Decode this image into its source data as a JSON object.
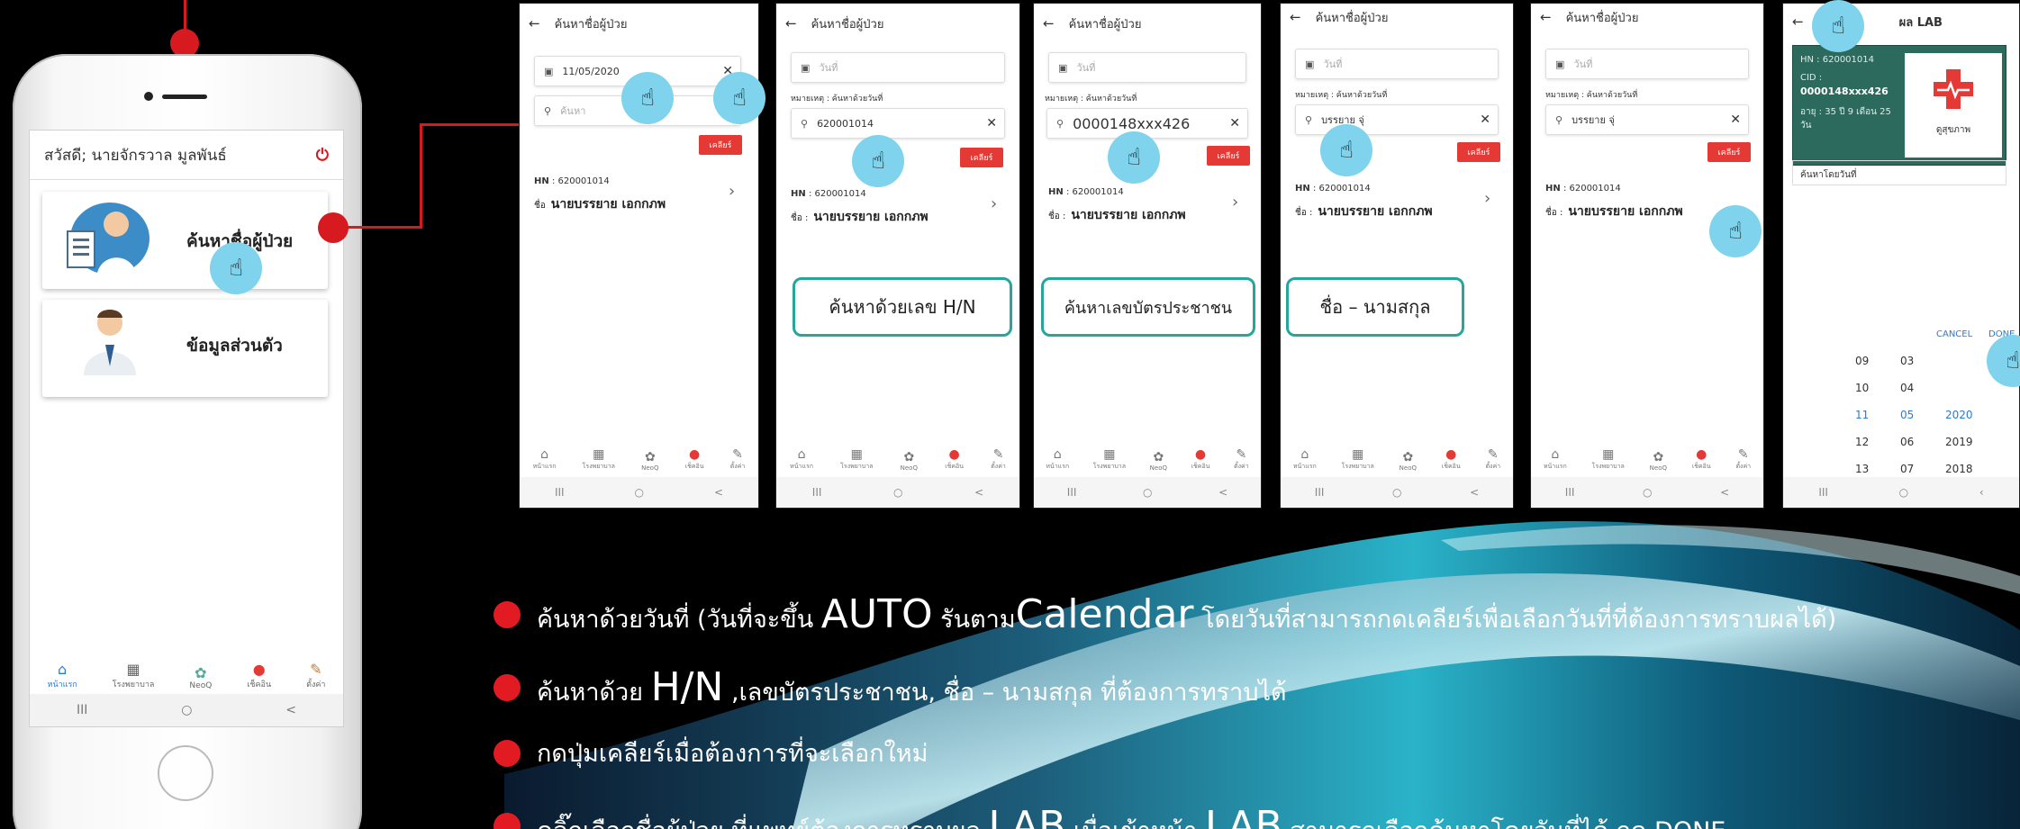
{
  "colors": {
    "accent": "#d71920",
    "teal": "#26a69a",
    "bullet": "#e21b22",
    "tap": "#7fd3ec"
  },
  "main_phone": {
    "greeting": "สวัสดี; นายจักรวาล มูลพันธ์",
    "power_icon": "power-icon",
    "cards": [
      {
        "label": "ค้นหาชื่อผู้ป่วย",
        "icon": "doctor-clipboard-icon"
      },
      {
        "label": "ข้อมูลส่วนตัว",
        "icon": "doctor-avatar-icon"
      }
    ],
    "nav": [
      {
        "label": "หน้าแรก",
        "icon": "home-icon"
      },
      {
        "label": "โรงพยาบาล",
        "icon": "hospital-icon"
      },
      {
        "label": "NeoQ",
        "icon": "neoq-icon"
      },
      {
        "label": "เช็คอิน",
        "icon": "location-pin-icon"
      },
      {
        "label": "ตั้งค่า",
        "icon": "settings-icon"
      }
    ],
    "sys": [
      "III",
      "○",
      "<"
    ]
  },
  "screens": [
    {
      "title": "ค้นหาชื่อผู้ป่วย",
      "date_value": "11/05/2020",
      "search_placeholder": "ค้นหา",
      "clear_label": "เคลียร์",
      "hn_label": "HN",
      "hn_value": ": 620001014",
      "name_prefix": "ชื่อ",
      "name_value": "นายบรรยาย เอกกภพ"
    },
    {
      "title": "ค้นหาชื่อผู้ป่วย",
      "date_placeholder": "วันที่",
      "hint": "หมายเหตุ : ค้นหาด้วยวันที่",
      "search_value": "620001014",
      "clear_label": "เคลียร์",
      "hn_label": "HN",
      "hn_value": ": 620001014",
      "name_prefix": "ชื่อ :",
      "name_value": "นายบรรยาย เอกกภพ"
    },
    {
      "title": "ค้นหาชื่อผู้ป่วย",
      "date_placeholder": "วันที่",
      "hint": "หมายเหตุ : ค้นหาด้วยวันที่",
      "search_value": "0000148xxx426",
      "clear_label": "เคลียร์",
      "hn_label": "HN",
      "hn_value": ": 620001014",
      "name_prefix": "ชื่อ :",
      "name_value": "นายบรรยาย เอกกภพ"
    },
    {
      "title": "ค้นหาชื่อผู้ป่วย",
      "date_placeholder": "วันที่",
      "hint": "หมายเหตุ : ค้นหาด้วยวันที่",
      "search_value": "บรรยาย จุ่",
      "clear_label": "เคลียร์",
      "hn_label": "HN",
      "hn_value": ": 620001014",
      "name_prefix": "ชื่อ :",
      "name_value": "นายบรรยาย เอกกภพ"
    },
    {
      "title": "ค้นหาชื่อผู้ป่วย",
      "date_placeholder": "วันที่",
      "hint": "หมายเหตุ : ค้นหาด้วยวันที่",
      "search_value": "บรรยาย จุ่",
      "clear_label": "เคลียร์",
      "hn_label": "HN",
      "hn_value": ": 620001014",
      "name_prefix": "ชื่อ :",
      "name_value": "นายบรรยาย เอกกภพ"
    }
  ],
  "lab_screen": {
    "title": "ผล LAB",
    "hn": "HN : 620001014",
    "cid_label": "CID :",
    "cid_value": "0000148xxx426",
    "age": "อายุ : 35 ปี 9 เดือน 25 วัน",
    "health_label": "ดูสุขภาพ",
    "search_by_date": "ค้นหาโดยวันที่",
    "cancel": "CANCEL",
    "done": "DONE",
    "picker_rows": [
      [
        "09",
        "03",
        ""
      ],
      [
        "10",
        "04",
        ""
      ],
      [
        "11",
        "05",
        "2020"
      ],
      [
        "12",
        "06",
        "2019"
      ],
      [
        "13",
        "07",
        "2018"
      ]
    ]
  },
  "pills": [
    "ค้นหาด้วยเลข H/N",
    "ค้นหาเลขบัตรประชาชน",
    "ชื่อ – นามสกุล"
  ],
  "bullets": [
    {
      "a": "ค้นหาด้วยวันที่ (วันที่จะขึ้น ",
      "b": "AUTO",
      "c": " รันตาม",
      "d": "Calendar",
      "e": " โดยวันที่สามารถกดเคลียร์เพื่อเลือกวันที่ที่ต้องการทราบผลได้)"
    },
    {
      "a": "ค้นหาด้วย ",
      "b": "H/N",
      "c": " ,เลขบัตรประชาชน, ชื่อ – นามสกุล ที่ต้องการทราบได้",
      "d": "",
      "e": ""
    },
    {
      "a": "กดปุ่มเคลียร์เมื่อต้องการที่จะเลือกใหม่",
      "b": "",
      "c": "",
      "d": "",
      "e": ""
    },
    {
      "a": "คลิ๊กเลือกชื่อผู้ป่วย ที่แพทย์ต้องการทราบผล ",
      "b": "LAB",
      "c": " เมื่อเข้าหน้า ",
      "d": "LAB",
      "e": " สามารถเลือกค้นหาโดยวันที่ได้ กด DONE"
    }
  ]
}
